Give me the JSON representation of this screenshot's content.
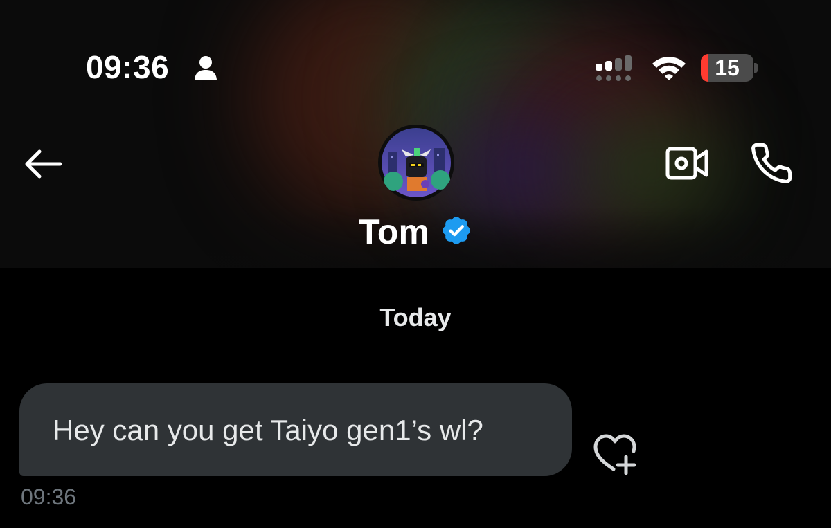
{
  "status_bar": {
    "time": "09:36",
    "battery_level": "15",
    "battery_fraction": 0.15,
    "icons": [
      "person-icon",
      "signal-icon",
      "wifi-icon",
      "battery-icon"
    ]
  },
  "header": {
    "contact_name": "Tom",
    "verified": true,
    "icons": [
      "back-arrow-icon",
      "video-camera-icon",
      "phone-icon",
      "verified-badge-icon"
    ]
  },
  "conversation": {
    "day_separator": "Today",
    "messages": [
      {
        "text": "Hey can you get Taiyo gen1’s wl?",
        "time": "09:36",
        "direction": "incoming",
        "reaction_icon": "heart-plus-icon"
      }
    ]
  },
  "colors": {
    "background": "#000000",
    "bubble": "#2f3336",
    "timestamp": "#6e767d",
    "verified_blue": "#1d9bf0",
    "battery_low": "#ff3b30",
    "text": "#e7e9ea"
  }
}
